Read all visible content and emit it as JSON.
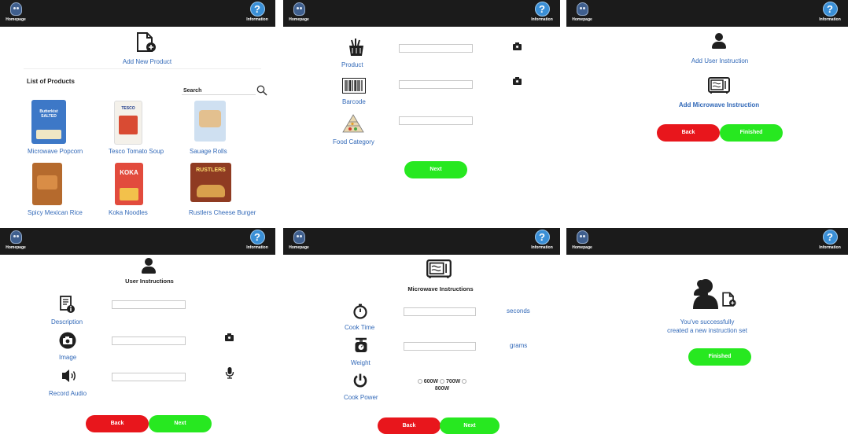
{
  "common": {
    "homepage": "Homepage",
    "information": "Information",
    "q": "?"
  },
  "p1": {
    "add_product": "Add New Product",
    "list_title": "List of Products",
    "search_label": "Search",
    "products": [
      {
        "name": "Microwave Popcorn",
        "pack": "Butterkist SALTED",
        "color": "#3d78c7"
      },
      {
        "name": "Tesco Tomato Soup",
        "pack": "TESCO",
        "color": "#d94b33"
      },
      {
        "name": "Sauage Rolls",
        "pack": "",
        "color": "#cfe0f1"
      },
      {
        "name": "Spicy Mexican Rice",
        "pack": "",
        "color": "#b56a2d"
      },
      {
        "name": "Koka Noodles",
        "pack": "KOKA",
        "color": "#e24b3d"
      },
      {
        "name": "Rustlers Cheese Burger",
        "pack": "RUSTLERS",
        "color": "#8f3b22"
      }
    ]
  },
  "p2": {
    "product": "Product",
    "barcode": "Barcode",
    "food_category": "Food Category",
    "next": "Next"
  },
  "p3": {
    "add_user": "Add User Instruction",
    "add_microwave": "Add Microwave Instruction",
    "back": "Back",
    "finished": "Finished"
  },
  "p4": {
    "title": "User Instructions",
    "description": "Description",
    "image": "Image",
    "record_audio": "Record Audio",
    "back": "Back",
    "next": "Next"
  },
  "p5": {
    "title": "Microwave Instructions",
    "cook_time": "Cook Time",
    "seconds": "seconds",
    "weight": "Weight",
    "grams": "grams",
    "cook_power": "Cook Power",
    "p600": "600W",
    "p700": "700W",
    "p800": "800W",
    "back": "Back",
    "next": "Next"
  },
  "p6": {
    "line1": "You've successfully",
    "line2": "created a new instruction set",
    "finished": "Finished"
  }
}
